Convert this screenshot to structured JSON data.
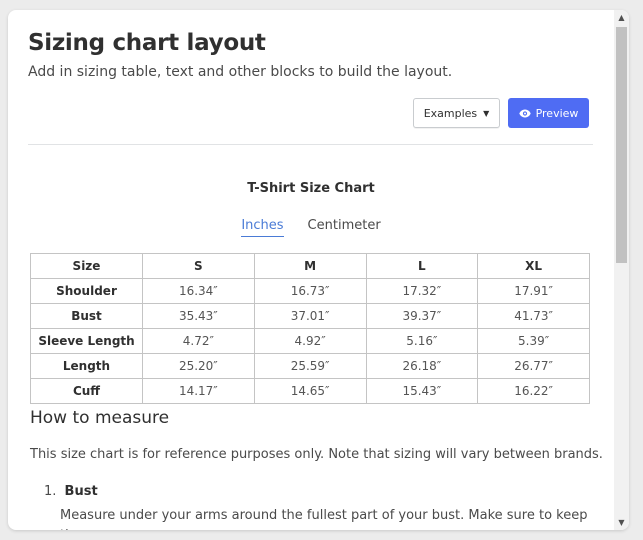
{
  "header": {
    "title": "Sizing chart layout",
    "subtitle": "Add in sizing table, text and other blocks to build the layout."
  },
  "toolbar": {
    "examples_label": "Examples",
    "preview_label": "Preview"
  },
  "chart": {
    "title": "T-Shirt Size Chart",
    "unit_tabs": [
      "Inches",
      "Centimeter"
    ],
    "active_unit": "Inches",
    "table": {
      "columns": [
        "Size",
        "S",
        "M",
        "L",
        "XL"
      ],
      "rows": [
        [
          "Shoulder",
          "16.34″",
          "16.73″",
          "17.32″",
          "17.91″"
        ],
        [
          "Bust",
          "35.43″",
          "37.01″",
          "39.37″",
          "41.73″"
        ],
        [
          "Sleeve Length",
          "4.72″",
          "4.92″",
          "5.16″",
          "5.39″"
        ],
        [
          "Length",
          "25.20″",
          "25.59″",
          "26.18″",
          "26.77″"
        ],
        [
          "Cuff",
          "14.17″",
          "14.65″",
          "15.43″",
          "16.22″"
        ]
      ]
    }
  },
  "measure": {
    "heading": "How to measure",
    "note": "This size chart is for reference purposes only. Note that sizing will vary between brands.",
    "items": [
      {
        "number": "1.",
        "name": "Bust",
        "description": "Measure under your arms around the fullest part of your bust. Make sure to keep the"
      }
    ]
  },
  "colors": {
    "accent": "#4f6cf3",
    "link": "#4a7bd6"
  }
}
